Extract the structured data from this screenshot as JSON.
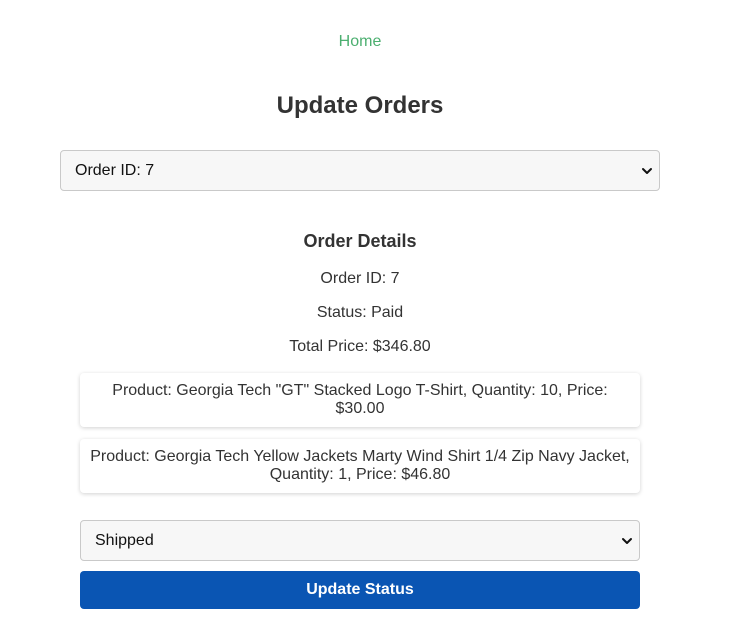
{
  "nav": {
    "home_label": "Home"
  },
  "page": {
    "title": "Update Orders"
  },
  "order_select": {
    "selected_value": "Order ID: 7",
    "icon": "chevron-down-icon"
  },
  "details": {
    "title": "Order Details",
    "order_id": "Order ID: 7",
    "status": "Status: Paid",
    "total_price": "Total Price: $346.80"
  },
  "products": [
    {
      "text": "Product: Georgia Tech \"GT\" Stacked Logo T-Shirt, Quantity: 10, Price: $30.00"
    },
    {
      "text": "Product: Georgia Tech Yellow Jackets Marty Wind Shirt 1/4 Zip Navy Jacket, Quantity: 1, Price: $46.80"
    }
  ],
  "status_select": {
    "selected_value": "Shipped",
    "icon": "chevron-down-icon"
  },
  "actions": {
    "update_label": "Update Status"
  },
  "colors": {
    "link": "#4caf70",
    "primary_button": "#0a55b3",
    "text": "#333333"
  }
}
